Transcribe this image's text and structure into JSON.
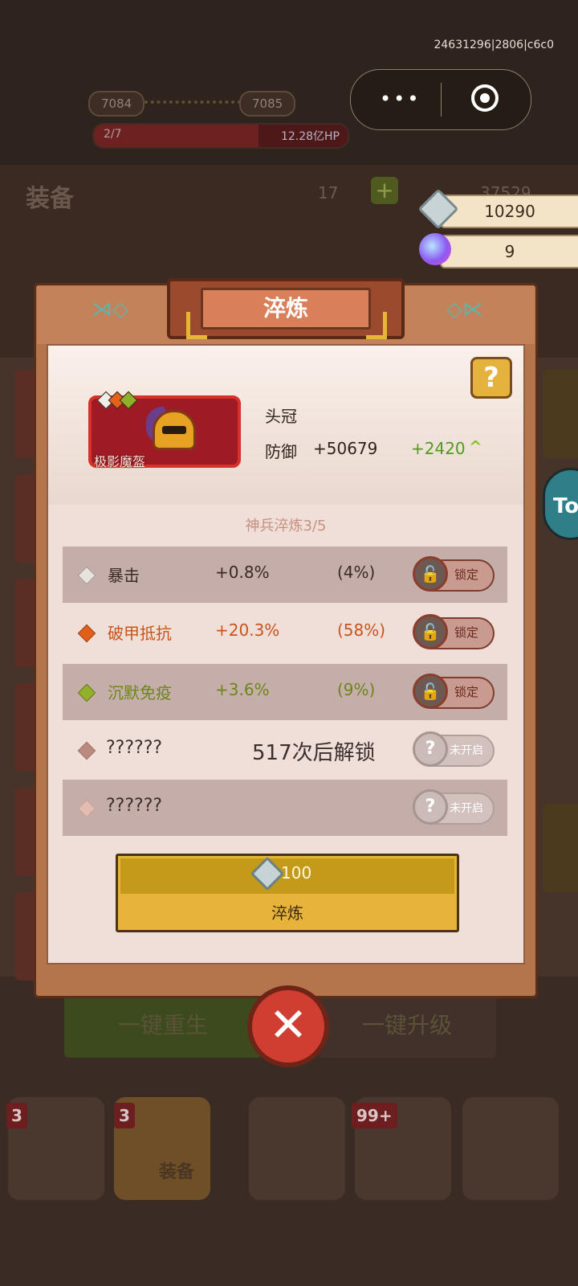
{
  "overlay": {
    "build_id": "24631296|2806|c6c0"
  },
  "capsule": {
    "more_glyph": "•••"
  },
  "stage": {
    "level_current": "7084",
    "level_next": "7085",
    "wave": "2/7",
    "boss_hp": "12.28亿HP"
  },
  "equip_panel": {
    "title": "装备",
    "count": "17",
    "gold": "37529"
  },
  "resources": {
    "crystal": "10290",
    "orb": "9"
  },
  "side_tab": "To",
  "modal": {
    "title": "淬炼",
    "help_glyph": "?",
    "item": {
      "name": "极影魔盔",
      "slot": "头冠",
      "stat_label": "防御",
      "stat_value": "+50679",
      "stat_bonus": "+2420",
      "up_arrow": "^"
    },
    "progress": "神兵淬炼3/5",
    "attributes": [
      {
        "name": "暴击",
        "value": "+0.8%",
        "percent": "(4%)",
        "color": "#3b2a24",
        "gem": "#e8e2dc",
        "lock_label": "锁定"
      },
      {
        "name": "破甲抵抗",
        "value": "+20.3%",
        "percent": "(58%)",
        "color": "#c8541a",
        "gem": "#e0601a",
        "lock_label": "锁定"
      },
      {
        "name": "沉默免疫",
        "value": "+3.6%",
        "percent": "(9%)",
        "color": "#6d8618",
        "gem": "#93b02a",
        "lock_label": "锁定"
      }
    ],
    "locked_rows": [
      {
        "name": "??????",
        "note": "517次后解锁",
        "state": "未开启"
      },
      {
        "name": "??????",
        "note": "",
        "state": "未开启"
      }
    ],
    "refine_cost": "100",
    "refine_button": "淬炼",
    "close_glyph": "✕"
  },
  "bottom_actions": {
    "rebirth": "一键重生",
    "upgrade": "一键升级"
  },
  "bottom_nav": {
    "badges": [
      "3",
      "3",
      "99+"
    ],
    "active_label": "装备"
  },
  "colors": {
    "accent_gold": "#e8b33b",
    "close_red": "#cf3e30",
    "bonus_green": "#4f9c1e"
  }
}
